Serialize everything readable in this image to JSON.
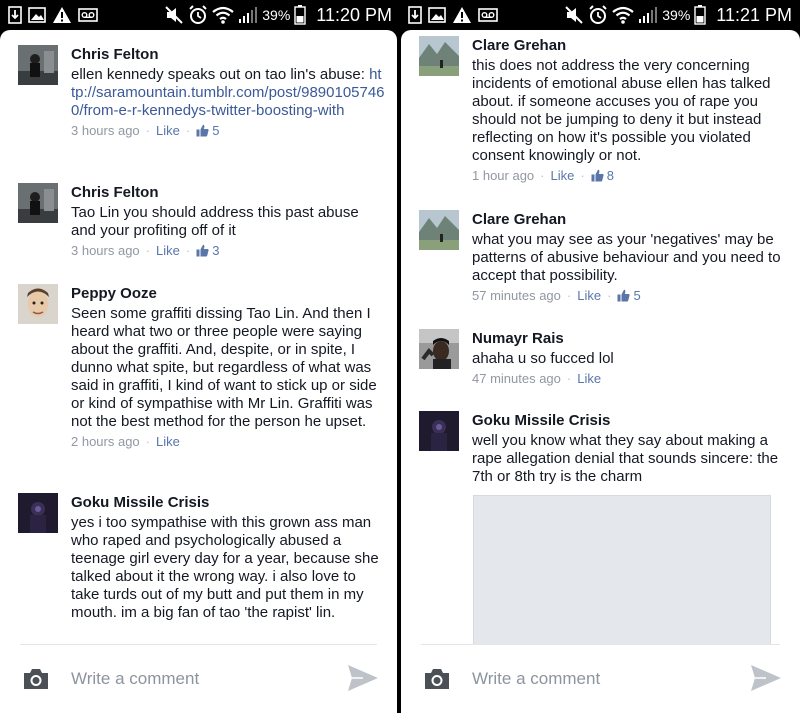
{
  "panels": [
    {
      "status": {
        "battery": "39%",
        "time": "11:20 PM"
      },
      "comments": [
        {
          "name": "Chris Felton",
          "text_before": "ellen kennedy speaks out on tao lin's abuse: ",
          "link": "http://saramountain.tumblr.com/post/98901057460/from-e-r-kennedys-twitter-boosting-with",
          "time": "3 hours ago",
          "like_label": "Like",
          "likes": "5"
        },
        {
          "name": "Chris Felton",
          "text": "Tao Lin you should address this past abuse and your profiting off of it",
          "time": "3 hours ago",
          "like_label": "Like",
          "likes": "3"
        },
        {
          "name": "Peppy Ooze",
          "text": "Seen some graffiti dissing Tao Lin. And then I heard what two or three people were saying about the graffiti. And, despite, or in spite, I dunno what spite, but regardless of what was said in graffiti, I kind of want to stick up or side or kind of sympathise with Mr Lin. Graffiti was not the best method for the person he upset.",
          "time": "2 hours ago",
          "like_label": "Like"
        },
        {
          "name": "Goku Missile Crisis",
          "text": "yes i too sympathise with this grown ass man who raped and psychologically abused a teenage girl every day for a year, because she talked about it the wrong way. i also love to take turds out of my butt and put them in my mouth. im a big fan of tao 'the rapist' lin."
        }
      ],
      "composer": {
        "placeholder": "Write a comment"
      }
    },
    {
      "status": {
        "battery": "39%",
        "time": "11:21 PM"
      },
      "comments": [
        {
          "name": "Clare Grehan",
          "text": "this does not address the very concerning incidents of emotional abuse ellen has talked about. if someone accuses you of rape you should not be jumping to deny it but instead reflecting on how it's possible you violated consent knowingly or not.",
          "time": "1 hour ago",
          "like_label": "Like",
          "likes": "8"
        },
        {
          "name": "Clare Grehan",
          "text": "what you may see as your 'negatives' may be patterns of abusive behaviour and you need to accept that possibility.",
          "time": "57 minutes ago",
          "like_label": "Like",
          "likes": "5"
        },
        {
          "name": "Numayr Rais",
          "text": "ahaha u so fucced lol",
          "time": "47 minutes ago",
          "like_label": "Like"
        },
        {
          "name": "Goku Missile Crisis",
          "text": "well you know what they say about making a rape allegation denial that sounds sincere: the 7th or 8th try is the charm"
        }
      ],
      "composer": {
        "placeholder": "Write a comment"
      }
    }
  ]
}
